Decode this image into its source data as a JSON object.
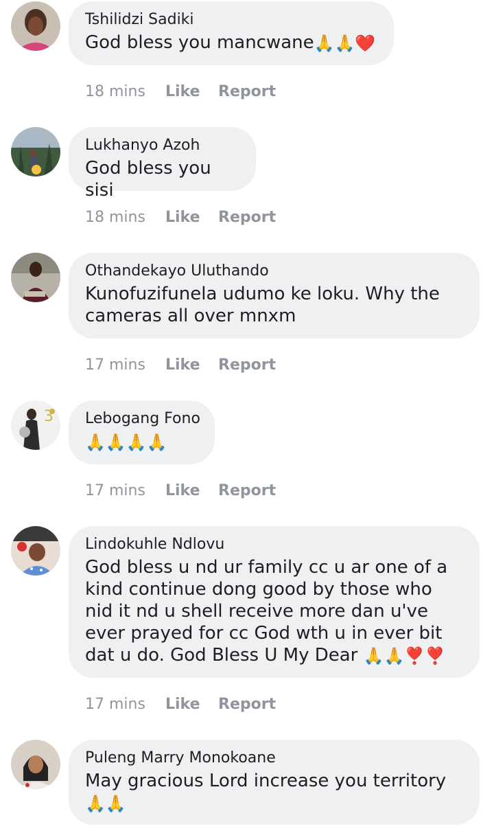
{
  "comments": [
    {
      "author": "Tshilidzi Sadiki",
      "text": "God bless you mancwane",
      "emoji": "🙏🙏❤️",
      "time": "18 mins",
      "like": "Like",
      "report": "Report"
    },
    {
      "author": "Lukhanyo Azoh",
      "text": "God bless you sisi",
      "emoji": "",
      "time": "18 mins",
      "like": "Like",
      "report": "Report"
    },
    {
      "author": "Othandekayo Uluthando",
      "text": "Kunofuzifunela udumo ke loku. Why the cameras all over mnxm",
      "emoji": "",
      "time": "17 mins",
      "like": "Like",
      "report": "Report"
    },
    {
      "author": "Lebogang Fono",
      "text": "",
      "emoji": "🙏🙏🙏🙏",
      "time": "17 mins",
      "like": "Like",
      "report": "Report"
    },
    {
      "author": "Lindokuhle Ndlovu",
      "text": "God bless u nd ur family cc u ar one of a kind continue dong good by those who nid it nd u shell receive more dan u've ever prayed for cc God wth u in ever bit dat u do. God Bless U My Dear",
      "emoji": "🙏🙏❣️❣️",
      "time": "17 mins",
      "like": "Like",
      "report": "Report"
    },
    {
      "author": "Puleng Marry Monokoane",
      "text": "May gracious Lord increase you territory",
      "emoji": "🙏🙏",
      "time": "",
      "like": "",
      "report": ""
    }
  ]
}
